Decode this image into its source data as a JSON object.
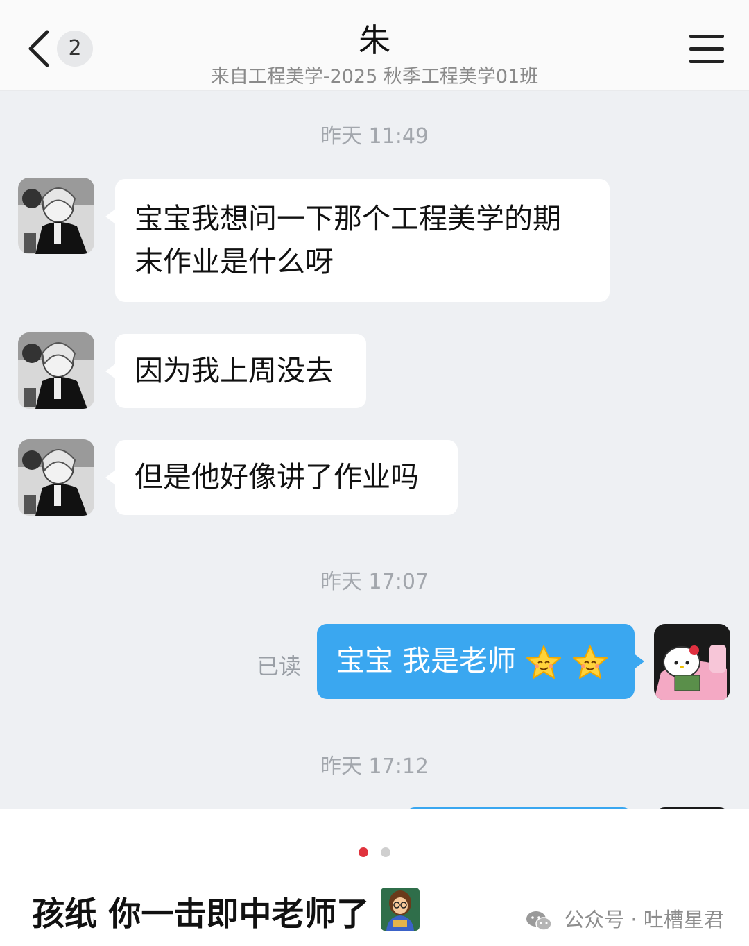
{
  "header": {
    "unread_count": "2",
    "title": "朱",
    "subtitle": "来自工程美学-2025 秋季工程美学01班"
  },
  "messages": [
    {
      "type": "time",
      "text": "昨天 11:49"
    },
    {
      "type": "in",
      "lines": [
        "宝宝我想问一下那个工程美学的期",
        "末作业是什么呀"
      ]
    },
    {
      "type": "in",
      "lines": [
        "因为我上周没去"
      ]
    },
    {
      "type": "in",
      "lines": [
        "但是他好像讲了作业吗"
      ]
    },
    {
      "type": "time",
      "text": "昨天 17:07"
    },
    {
      "type": "out",
      "text": "宝宝 我是老师",
      "emoji": [
        "star-smile",
        "star-smile"
      ],
      "read_status": "已读"
    },
    {
      "type": "time",
      "text": "昨天 17:12"
    }
  ],
  "caption": {
    "text": "孩纸 你一击即中老师了",
    "emoji": "teacher-emoji"
  },
  "watermark": {
    "text": "公众号 · 吐槽星君",
    "icon": "wechat-icon"
  },
  "colors": {
    "chat_bg": "#eef0f3",
    "out_bubble": "#3aa7f0",
    "active_dot": "#e0333d"
  }
}
